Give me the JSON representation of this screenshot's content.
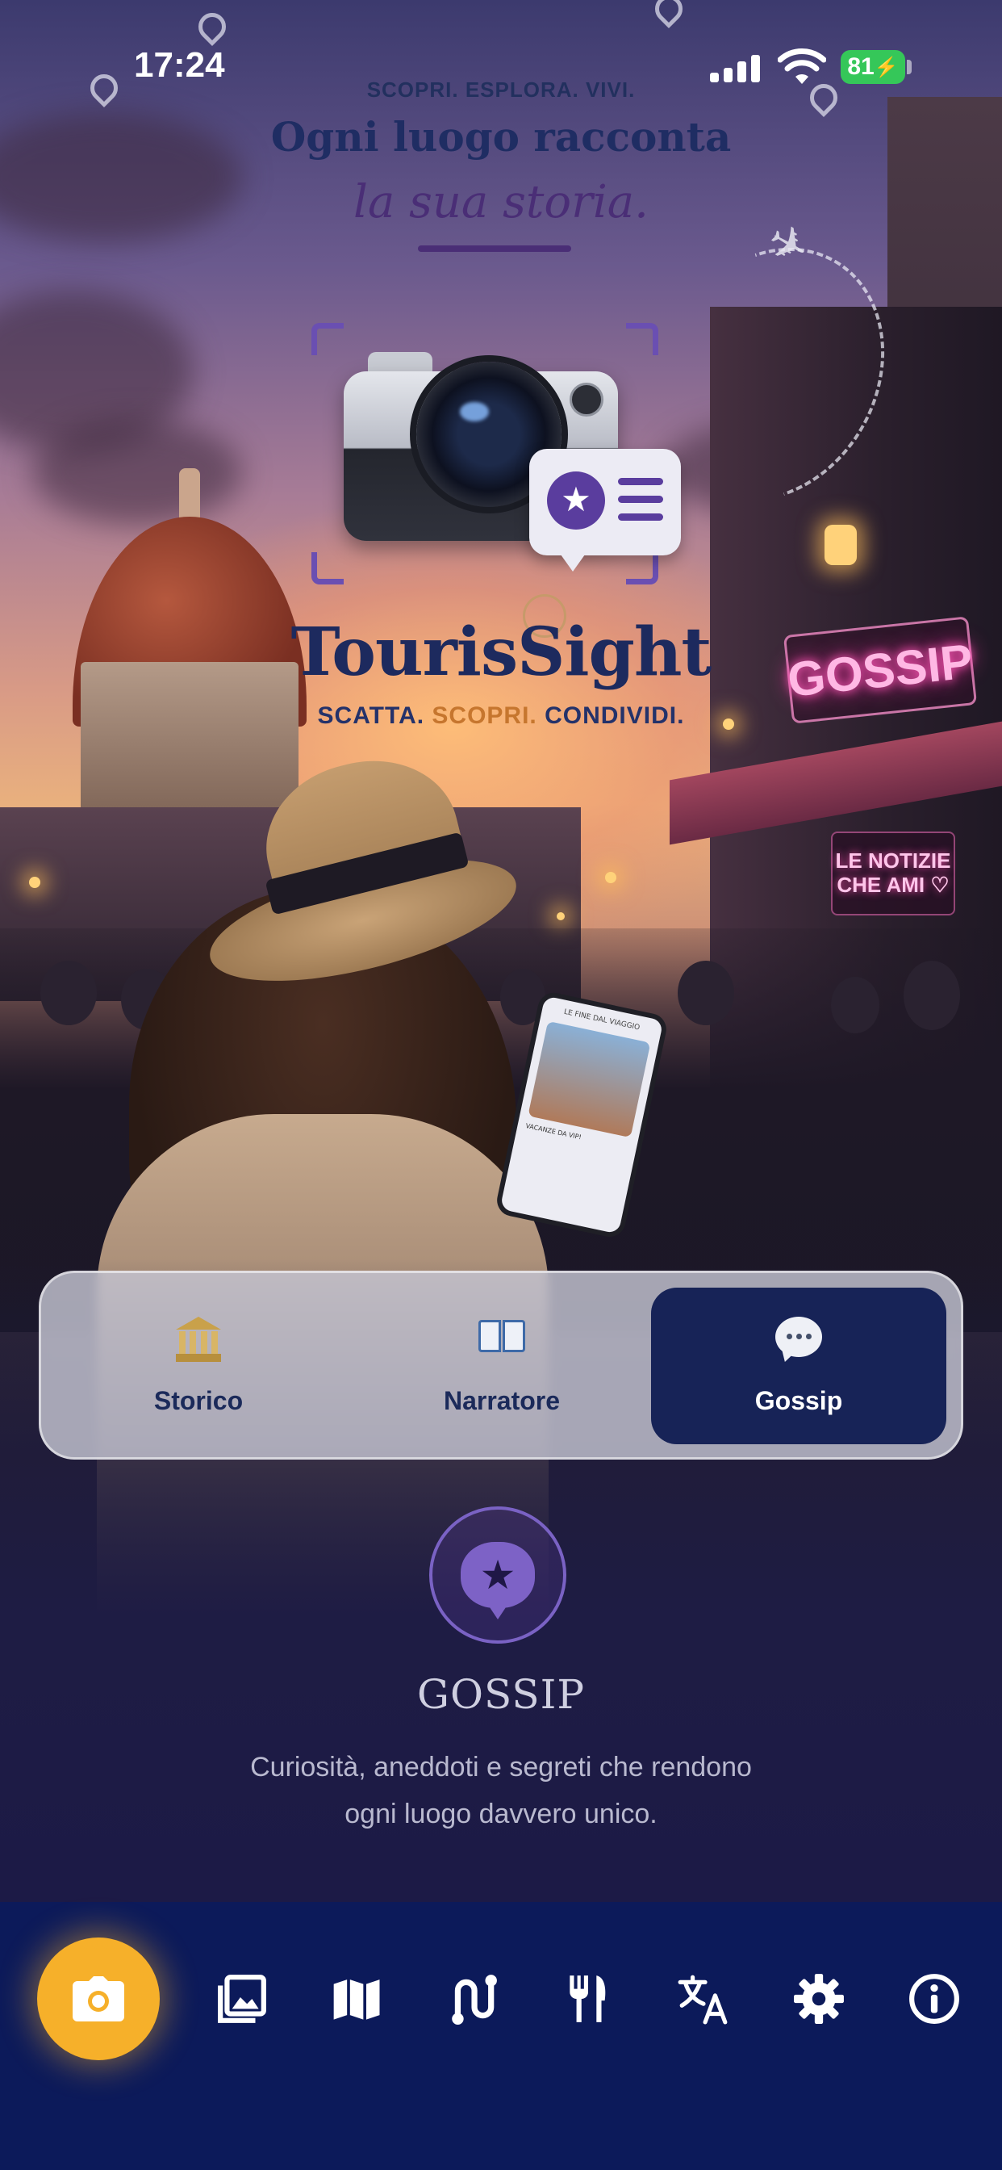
{
  "status_bar": {
    "time": "17:24",
    "battery": "81"
  },
  "branding": {
    "tagline_top": "SCOPRI. ESPLORA. VIVI.",
    "headline_line1": "Ogni luogo racconta",
    "headline_line2": "la sua storia.",
    "app_name": "TourisSight",
    "slogan_part1": "SCATTA. ",
    "slogan_part2": "SCOPRI.",
    "slogan_part3": " CONDIVIDI."
  },
  "scene_signs": {
    "neon_sign": "GOSSIP",
    "shop_sign_line1": "LE NOTIZIE",
    "shop_sign_line2": "CHE AMI ♡",
    "phone_title": "LE FINE DAL VIAGGIO",
    "phone_caption": "VACANZE DA VIP!"
  },
  "mode_selector": {
    "selected": "Gossip",
    "tabs": [
      {
        "label": "Storico",
        "icon": "classical-building-icon"
      },
      {
        "label": "Narratore",
        "icon": "open-book-icon"
      },
      {
        "label": "Gossip",
        "icon": "speech-bubble-icon"
      }
    ]
  },
  "mode_detail": {
    "icon": "star-speech-bubble-icon",
    "title": "GOSSIP",
    "description": "Curiosità, aneddoti e segreti che rendono ogni luogo davvero unico."
  },
  "bottom_nav": {
    "items": [
      {
        "icon": "camera-icon"
      },
      {
        "icon": "gallery-icon"
      },
      {
        "icon": "map-icon"
      },
      {
        "icon": "route-icon"
      },
      {
        "icon": "restaurant-icon"
      },
      {
        "icon": "translate-icon"
      },
      {
        "icon": "settings-icon"
      },
      {
        "icon": "info-icon"
      }
    ]
  },
  "colors": {
    "accent": "#f6b02a",
    "nav_background": "#0c1a5a",
    "active_tab": "#172357",
    "brand_purple": "#5a3d9e"
  }
}
